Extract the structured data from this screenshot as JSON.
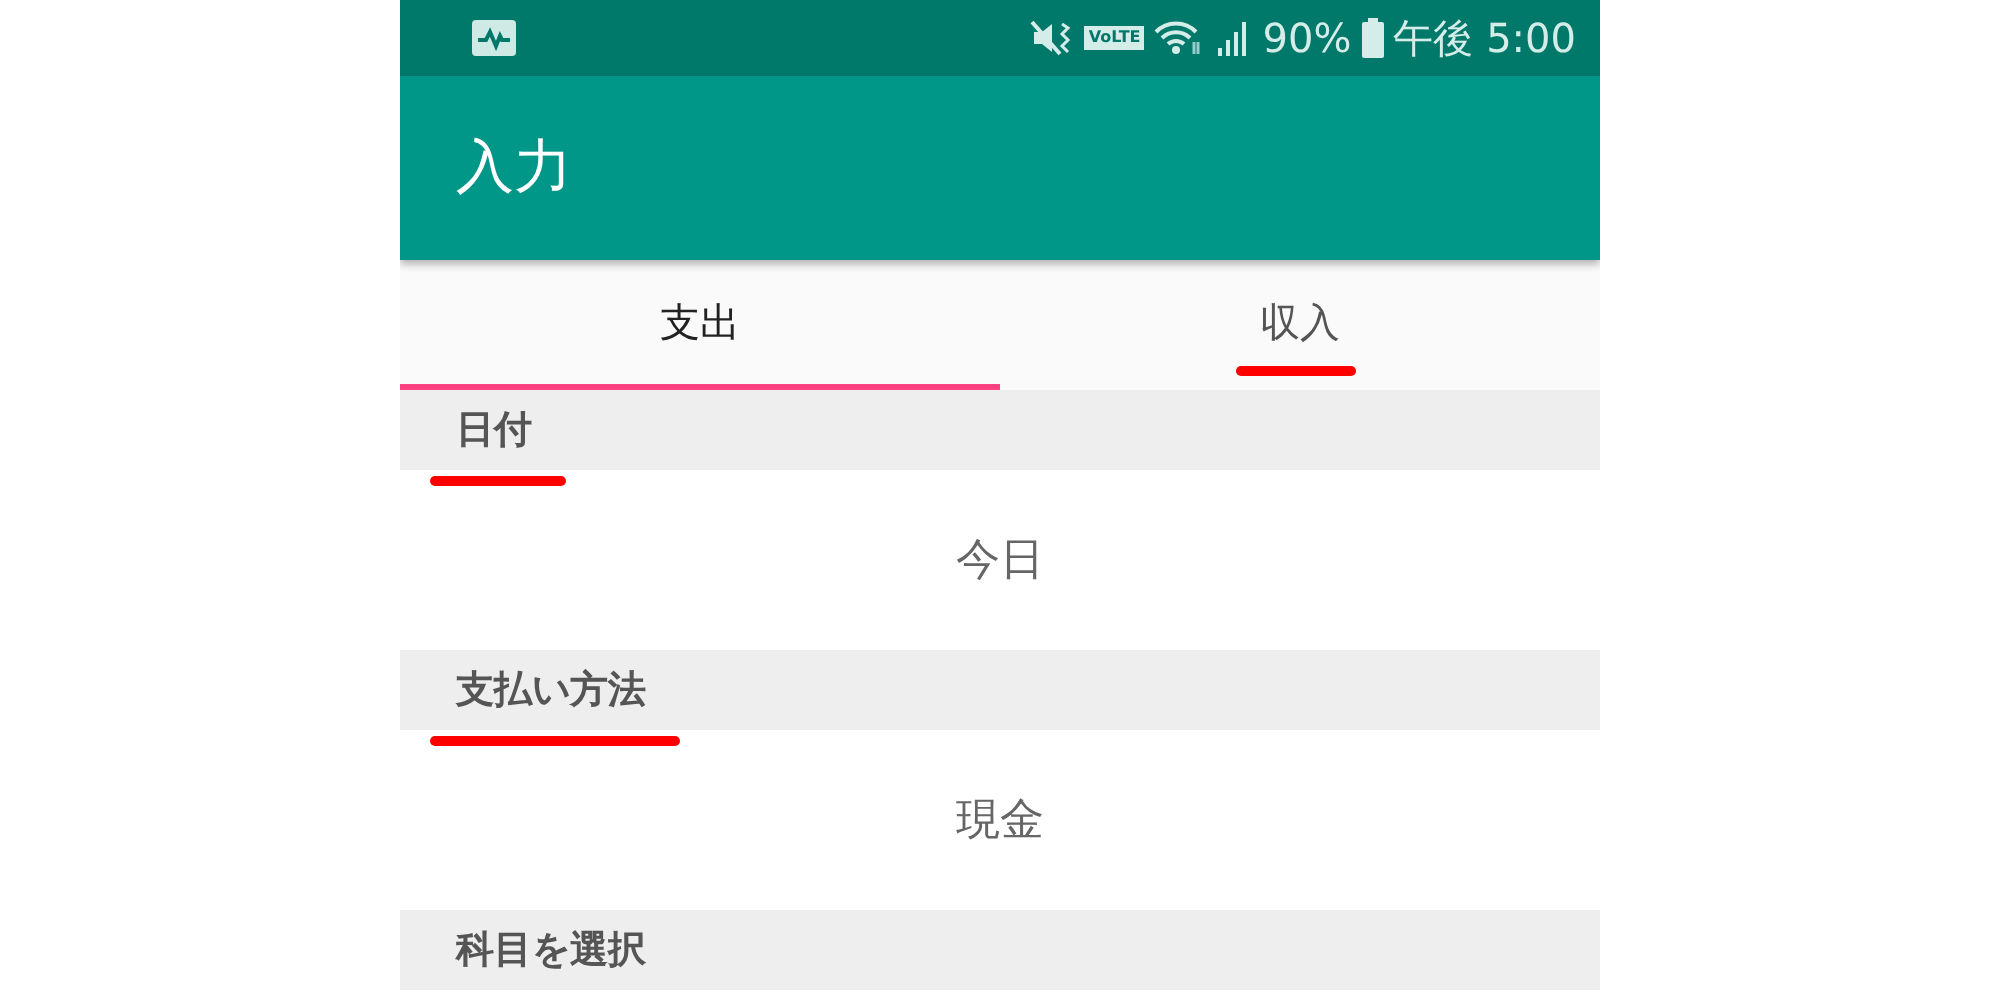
{
  "status_bar": {
    "volte": "VoLTE",
    "battery": "90%",
    "time": "午後 5:00"
  },
  "app_bar": {
    "title": "入力"
  },
  "tabs": [
    {
      "label": "支出",
      "selected": true,
      "marked": false
    },
    {
      "label": "収入",
      "selected": false,
      "marked": true
    }
  ],
  "sections": [
    {
      "header": "日付",
      "marked": true,
      "value": "今日"
    },
    {
      "header": "支払い方法",
      "marked": true,
      "value": "現金"
    },
    {
      "header": "科目を選択",
      "marked": false
    }
  ]
}
